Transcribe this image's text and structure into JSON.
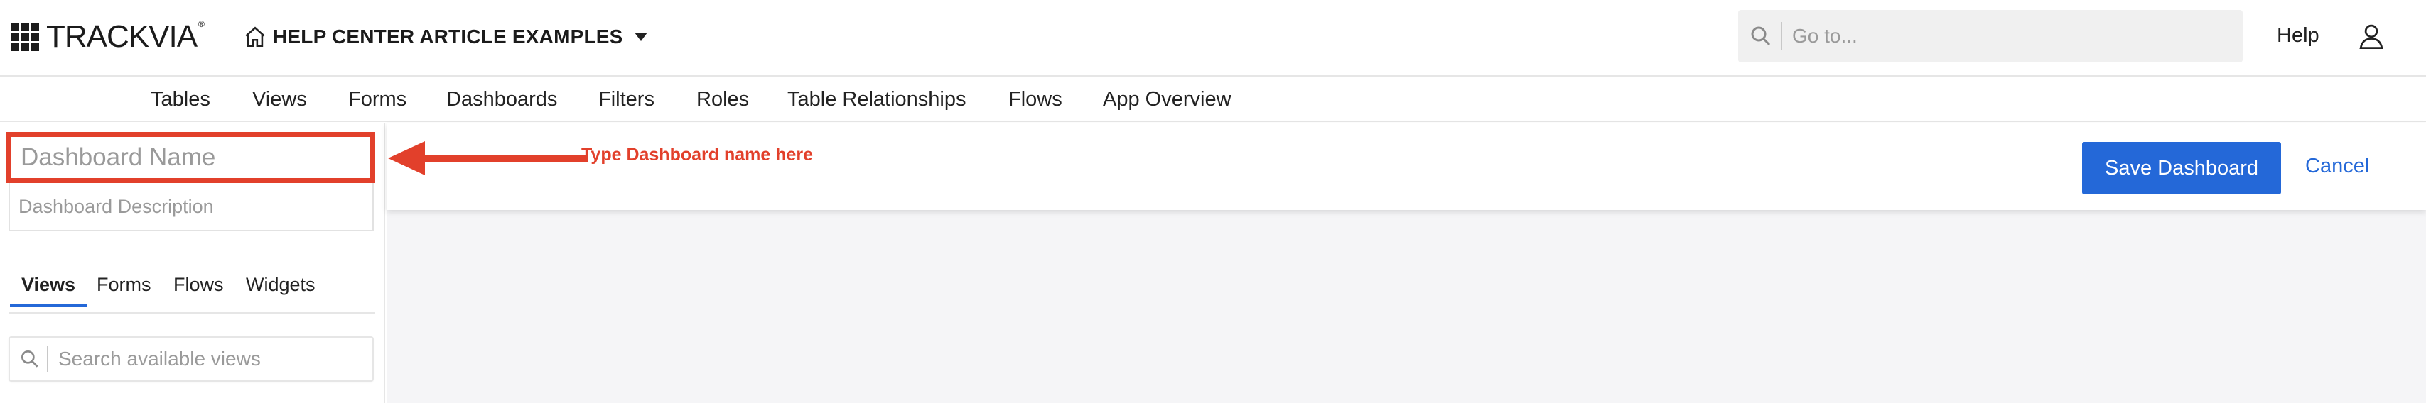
{
  "brand": {
    "logo_text": "TRACKVIA",
    "trademark": "®"
  },
  "header": {
    "app_name": "HELP CENTER ARTICLE EXAMPLES",
    "goto_placeholder": "Go to...",
    "help_label": "Help"
  },
  "nav": {
    "items": [
      "Tables",
      "Views",
      "Forms",
      "Dashboards",
      "Filters",
      "Roles",
      "Table Relationships",
      "Flows",
      "App Overview"
    ]
  },
  "left_panel": {
    "name_placeholder": "Dashboard Name",
    "description_placeholder": "Dashboard Description",
    "tabs": [
      "Views",
      "Forms",
      "Flows",
      "Widgets"
    ],
    "active_tab": "Views",
    "search_placeholder": "Search available views"
  },
  "toolbar": {
    "annotation": "Type Dashboard name here",
    "save_label": "Save Dashboard",
    "cancel_label": "Cancel"
  },
  "colors": {
    "accent": "#2468d8",
    "annotation_red": "#e2402b",
    "canvas_bg": "#f5f5f7"
  },
  "icons": [
    "grid-logo-icon",
    "home-icon",
    "chevron-down-icon",
    "search-icon",
    "user-icon",
    "arrow-left-icon"
  ]
}
